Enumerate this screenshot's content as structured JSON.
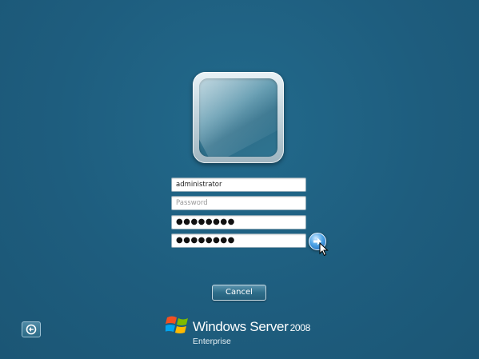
{
  "login": {
    "username_value": "administrator",
    "password_placeholder": "Password",
    "new_password_masked": "●●●●●●●●",
    "confirm_password_masked": "●●●●●●●●",
    "submit_icon": "arrow-right-icon",
    "cancel_label": "Cancel"
  },
  "bottom": {
    "ease_of_access_icon": "ease-of-access-icon"
  },
  "branding": {
    "product_name": "Windows Server",
    "version": "2008",
    "edition": "Enterprise",
    "logo_icon": "windows-flag-logo"
  },
  "colors": {
    "background": "#1e5d7e",
    "button_gradient_top": "#5b93ad",
    "go_button": "#4da3e6"
  }
}
